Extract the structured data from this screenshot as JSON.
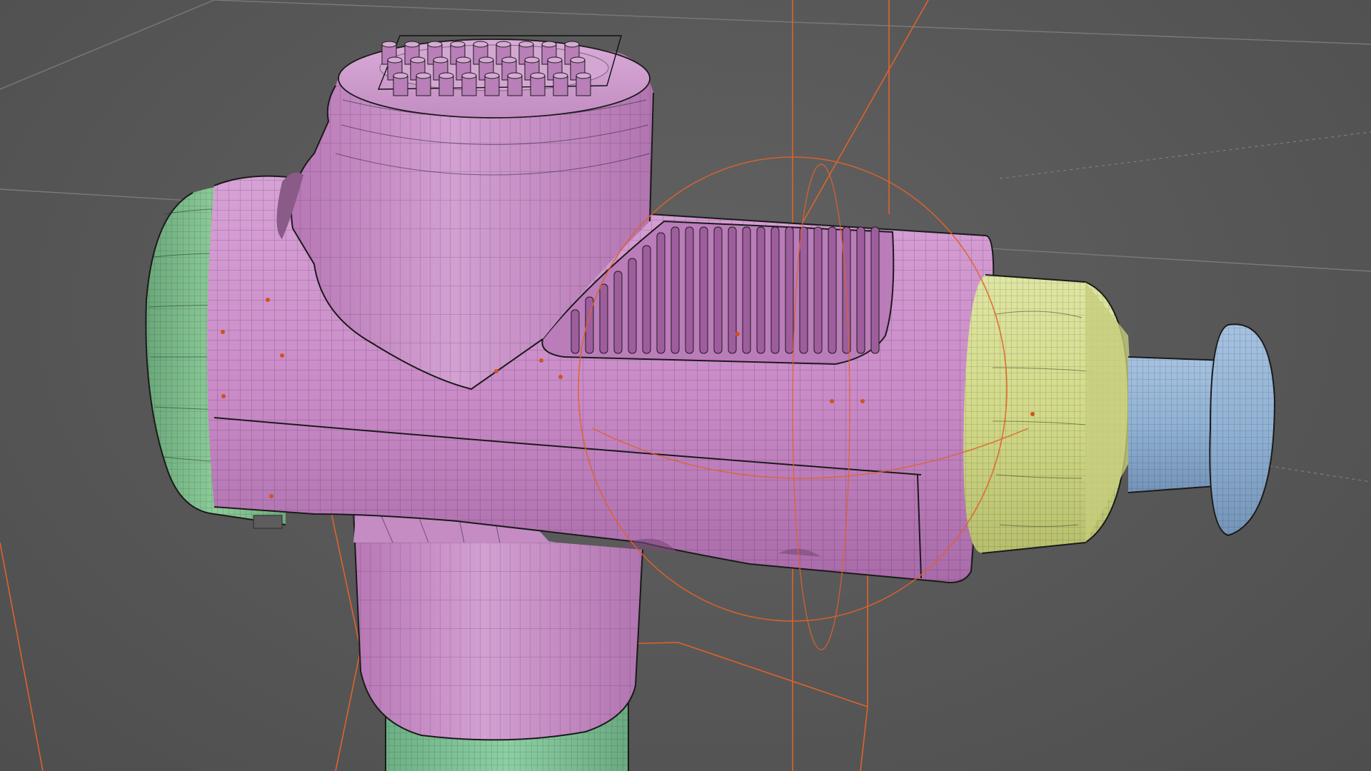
{
  "viewport": {
    "background": "#575757",
    "grid_color": "#7a7a7a",
    "selection_color": "#e0622a"
  },
  "model": {
    "body_color": "#c98ac7",
    "cap_color": "#7fbf8c",
    "knob_color": "#d8df8e",
    "head_color": "#8fb0d2",
    "handle_color": "#82c29a",
    "wire_color": "#2a1f2e"
  },
  "icons": {
    "gizmo": "rotate-gizmo-icon",
    "vertex": "vertex-dot-icon"
  }
}
